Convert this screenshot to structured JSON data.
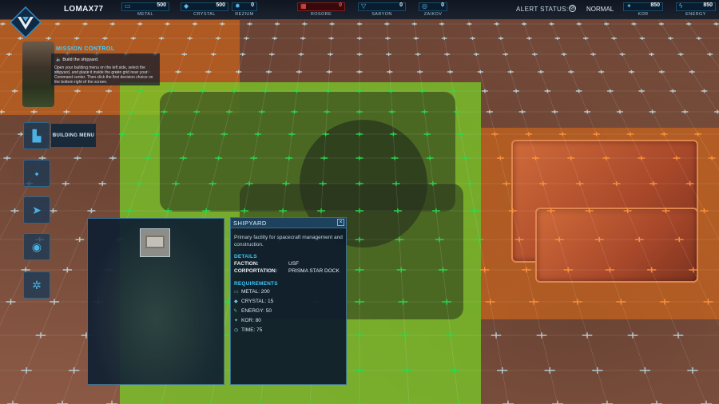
{
  "topbar": {
    "player_name": "LOMAX77",
    "resources": [
      {
        "label": "METAL",
        "value": "500",
        "icon": "metal-icon",
        "glyph": "▭"
      },
      {
        "label": "CRYSTAL",
        "value": "500",
        "icon": "crystal-icon",
        "glyph": "◆"
      },
      {
        "label": "REZIUM",
        "value": "0",
        "icon": "rezium-icon",
        "glyph": "✹"
      },
      {
        "label": "ROSORE",
        "value": "0",
        "icon": "rosore-icon",
        "glyph": "▦"
      },
      {
        "label": "SARYON",
        "value": "0",
        "icon": "saryon-icon",
        "glyph": "▽"
      },
      {
        "label": "ZAIKOV",
        "value": "0",
        "icon": "zaikov-icon",
        "glyph": "◎"
      },
      {
        "label": "KOR",
        "value": "850",
        "icon": "kor-icon",
        "glyph": "✦"
      },
      {
        "label": "ENERGY",
        "value": "850",
        "icon": "energy-icon",
        "glyph": "ϟ"
      }
    ],
    "alert_label": "ALERT STATUS:",
    "alert_value": "NORMAL"
  },
  "mission": {
    "title": "MISSION CONTROL",
    "task": "Build the shipyard.",
    "text": "Open your building menu on the left side, select the shipyard, and place it inside the green grid near your Command center. Then click the first decision choice on the bottom right of the screen."
  },
  "sidebar": {
    "building_menu_label": "BUILDING MENU",
    "buttons": [
      {
        "name": "building-menu-button",
        "icon": "building-icon",
        "glyph": "▙"
      },
      {
        "name": "defense-menu-button",
        "icon": "defense-icon",
        "glyph": "⬩"
      },
      {
        "name": "units-menu-button",
        "icon": "ship-icon",
        "glyph": "➤"
      },
      {
        "name": "research-menu-button",
        "icon": "research-icon",
        "glyph": "◉"
      },
      {
        "name": "tech-menu-button",
        "icon": "network-icon",
        "glyph": "✲"
      }
    ]
  },
  "building_info": {
    "title": "SHIPYARD",
    "description": "Primary facility for spacecraft management and construction.",
    "details_header": "DETAILS",
    "faction_label": "FACTION:",
    "faction_value": "USF",
    "corporation_label": "CORPORTATION:",
    "corporation_value": "PRISMA STAR DOCK",
    "requirements_header": "REQUIREMENTS",
    "requirements": [
      {
        "text": "METAL: 200",
        "icon": "metal-icon",
        "glyph": "▭"
      },
      {
        "text": "CRYSTAL: 15",
        "icon": "crystal-icon",
        "glyph": "◆"
      },
      {
        "text": "ENERGY: 50",
        "icon": "energy-icon",
        "glyph": "ϟ"
      },
      {
        "text": "KOR: 80",
        "icon": "kor-icon",
        "glyph": "✦"
      },
      {
        "text": "TIME: 75",
        "icon": "time-icon",
        "glyph": "◷"
      }
    ]
  },
  "colors": {
    "accent": "#3fc6f6",
    "alert_red": "#ff5a5a",
    "placement_green": "#78c828",
    "restricted_orange": "#e66e14"
  }
}
